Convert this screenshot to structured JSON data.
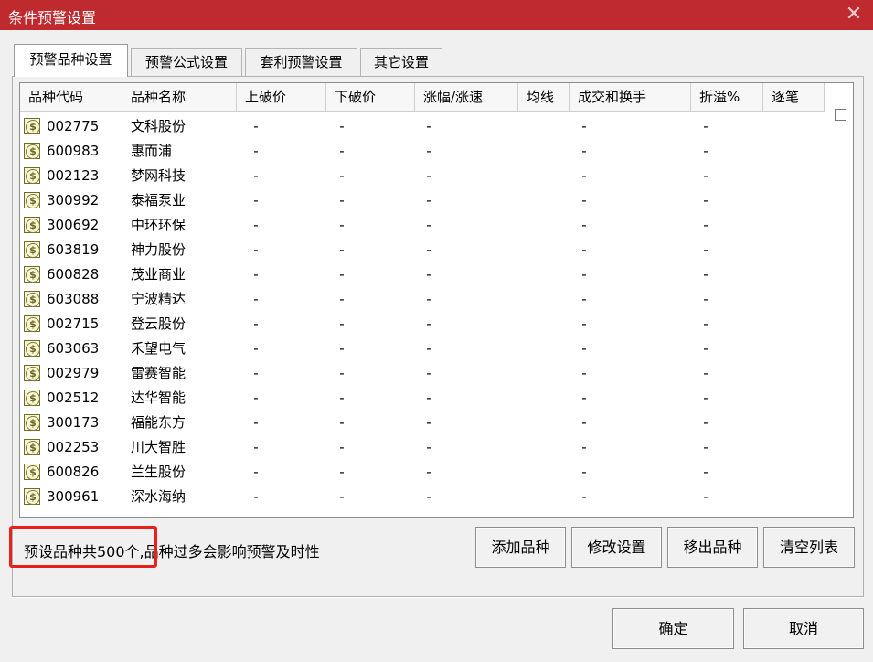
{
  "window": {
    "title": "条件预警设置",
    "close_glyph": "✕"
  },
  "tabs": [
    {
      "label": "预警品种设置"
    },
    {
      "label": "预警公式设置"
    },
    {
      "label": "套利预警设置"
    },
    {
      "label": "其它设置"
    }
  ],
  "table": {
    "headers": [
      "品种代码",
      "品种名称",
      "上破价",
      "下破价",
      "涨幅/涨速",
      "均线",
      "成交和换手",
      "折溢%",
      "逐笔"
    ],
    "dash": "-",
    "rows": [
      {
        "code": "002775",
        "name": "文科股份"
      },
      {
        "code": "600983",
        "name": "惠而浦"
      },
      {
        "code": "002123",
        "name": "梦网科技"
      },
      {
        "code": "300992",
        "name": "泰福泵业"
      },
      {
        "code": "300692",
        "name": "中环环保"
      },
      {
        "code": "603819",
        "name": "神力股份"
      },
      {
        "code": "600828",
        "name": "茂业商业"
      },
      {
        "code": "603088",
        "name": "宁波精达"
      },
      {
        "code": "002715",
        "name": "登云股份"
      },
      {
        "code": "603063",
        "name": "禾望电气"
      },
      {
        "code": "002979",
        "name": "雷赛智能"
      },
      {
        "code": "002512",
        "name": "达华智能"
      },
      {
        "code": "300173",
        "name": "福能东方"
      },
      {
        "code": "002253",
        "name": "川大智胜"
      },
      {
        "code": "600826",
        "name": "兰生股份"
      },
      {
        "code": "300961",
        "name": "深水海纳"
      }
    ]
  },
  "status": {
    "text": "预设品种共500个,品种过多会影响预警及时性"
  },
  "buttons": {
    "add": "添加品种",
    "modify": "修改设置",
    "remove": "移出品种",
    "clear": "清空列表",
    "ok": "确定",
    "cancel": "取消"
  }
}
